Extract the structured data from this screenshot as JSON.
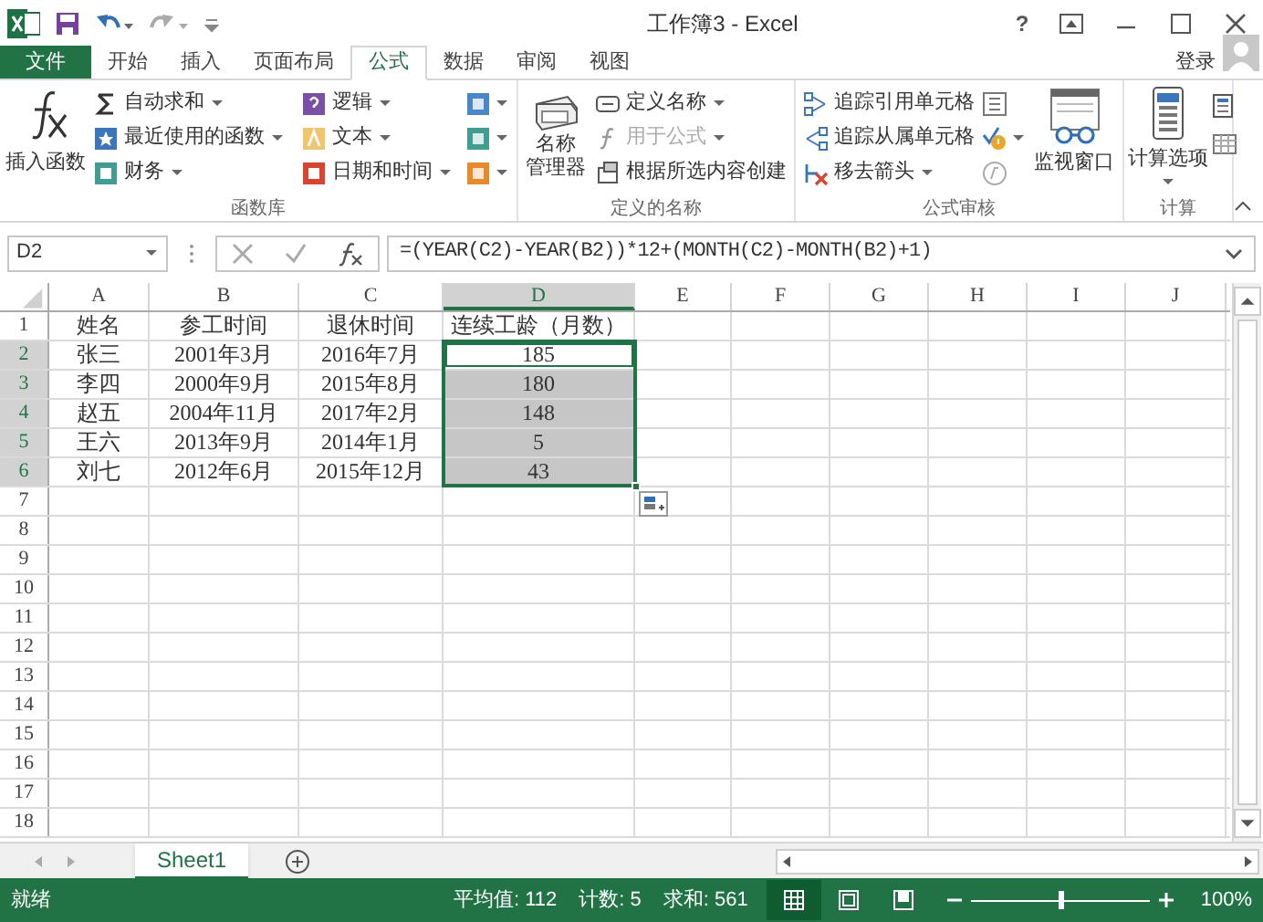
{
  "window": {
    "title": "工作簿3 - Excel",
    "help": "?",
    "sign_in": "登录"
  },
  "tabs": [
    {
      "label": "文件",
      "kind": "file",
      "selected": false
    },
    {
      "label": "开始",
      "kind": "tab",
      "selected": false
    },
    {
      "label": "插入",
      "kind": "tab",
      "selected": false
    },
    {
      "label": "页面布局",
      "kind": "tab",
      "selected": false
    },
    {
      "label": "公式",
      "kind": "tab",
      "selected": true
    },
    {
      "label": "数据",
      "kind": "tab",
      "selected": false
    },
    {
      "label": "审阅",
      "kind": "tab",
      "selected": false
    },
    {
      "label": "视图",
      "kind": "tab",
      "selected": false
    }
  ],
  "ribbon": {
    "function_library": {
      "title": "函数库",
      "insert_function": "插入函数",
      "items": [
        {
          "label": "自动求和",
          "dropdown": true
        },
        {
          "label": "最近使用的函数",
          "dropdown": true
        },
        {
          "label": "财务",
          "dropdown": true
        },
        {
          "label": "逻辑",
          "dropdown": true
        },
        {
          "label": "文本",
          "dropdown": true
        },
        {
          "label": "日期和时间",
          "dropdown": true
        }
      ],
      "more": [
        {
          "color": "#4a86c8"
        },
        {
          "color": "#3f9e8f"
        },
        {
          "color": "#e8892b"
        }
      ]
    },
    "defined_names": {
      "title": "定义的名称",
      "manager": [
        "名称",
        "管理器"
      ],
      "items": [
        {
          "label": "定义名称",
          "dropdown": true,
          "disabled": false
        },
        {
          "label": "用于公式",
          "dropdown": true,
          "disabled": true
        },
        {
          "label": "根据所选内容创建",
          "dropdown": false,
          "disabled": false
        }
      ]
    },
    "auditing": {
      "title": "公式审核",
      "watch": "监视窗口",
      "items": [
        {
          "label": "追踪引用单元格",
          "dropdown": false
        },
        {
          "label": "追踪从属单元格",
          "dropdown": false
        },
        {
          "label": "移去箭头",
          "dropdown": true
        }
      ]
    },
    "calculation": {
      "title": "计算",
      "options": "计算选项"
    }
  },
  "formula_bar": {
    "name_box": "D2",
    "formula": "=(YEAR(C2)-YEAR(B2))*12+(MONTH(C2)-MONTH(B2)+1)"
  },
  "sheet": {
    "columns": [
      {
        "label": "A",
        "selected": false
      },
      {
        "label": "B",
        "selected": false
      },
      {
        "label": "C",
        "selected": false
      },
      {
        "label": "D",
        "selected": true
      },
      {
        "label": "E",
        "selected": false
      },
      {
        "label": "F",
        "selected": false
      },
      {
        "label": "G",
        "selected": false
      },
      {
        "label": "H",
        "selected": false
      },
      {
        "label": "I",
        "selected": false
      },
      {
        "label": "J",
        "selected": false
      }
    ],
    "rows": [
      {
        "header": "1",
        "selected": false,
        "cells": [
          "姓名",
          "参工时间",
          "退休时间",
          "连续工龄（月数）"
        ],
        "d_active": false,
        "d_selected": false
      },
      {
        "header": "2",
        "selected": true,
        "cells": [
          "张三",
          "2001年3月",
          "2016年7月",
          "185"
        ],
        "d_active": true,
        "d_selected": true
      },
      {
        "header": "3",
        "selected": true,
        "cells": [
          "李四",
          "2000年9月",
          "2015年8月",
          "180"
        ],
        "d_active": false,
        "d_selected": true
      },
      {
        "header": "4",
        "selected": true,
        "cells": [
          "赵五",
          "2004年11月",
          "2017年2月",
          "148"
        ],
        "d_active": false,
        "d_selected": true
      },
      {
        "header": "5",
        "selected": true,
        "cells": [
          "王六",
          "2013年9月",
          "2014年1月",
          "5"
        ],
        "d_active": false,
        "d_selected": true
      },
      {
        "header": "6",
        "selected": true,
        "cells": [
          "刘七",
          "2012年6月",
          "2015年12月",
          "43"
        ],
        "d_active": false,
        "d_selected": true
      },
      {
        "header": "7",
        "selected": false
      },
      {
        "header": "8",
        "selected": false
      },
      {
        "header": "9",
        "selected": false
      },
      {
        "header": "10",
        "selected": false
      },
      {
        "header": "11",
        "selected": false
      },
      {
        "header": "12",
        "selected": false
      },
      {
        "header": "13",
        "selected": false
      },
      {
        "header": "14",
        "selected": false
      },
      {
        "header": "15",
        "selected": false
      },
      {
        "header": "16",
        "selected": false
      },
      {
        "header": "17",
        "selected": false
      },
      {
        "header": "18",
        "selected": false
      }
    ]
  },
  "sheet_tabs": [
    {
      "label": "Sheet1",
      "selected": true
    }
  ],
  "status_bar": {
    "status": "就绪",
    "average": "平均值: 112",
    "count": "计数: 5",
    "sum": "求和: 561",
    "views": [
      {
        "kind": "normal",
        "selected": true
      },
      {
        "kind": "layout",
        "selected": false
      },
      {
        "kind": "break",
        "selected": false
      }
    ],
    "zoom": {
      "level": 0.5,
      "reading": "100%"
    }
  }
}
